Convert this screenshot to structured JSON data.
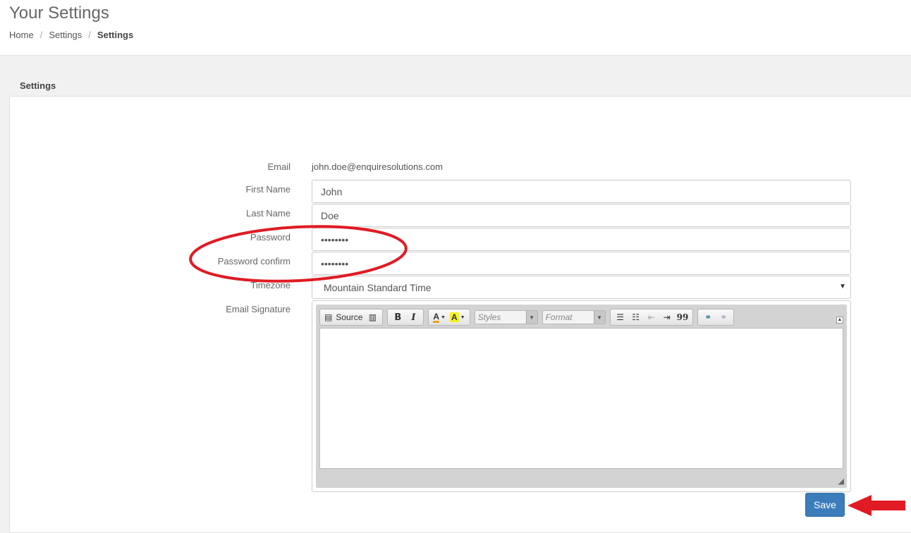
{
  "header": {
    "title": "Your Settings",
    "breadcrumb": [
      "Home",
      "Settings",
      "Settings"
    ],
    "separator": "/"
  },
  "panel": {
    "heading": "Settings"
  },
  "form": {
    "email_label": "Email",
    "email_value": "john.doe@enquiresolutions.com",
    "first_name_label": "First Name",
    "first_name_value": "John",
    "last_name_label": "Last Name",
    "last_name_value": "Doe",
    "password_label": "Password",
    "password_value": "••••••••",
    "password_confirm_label": "Password confirm",
    "password_confirm_value": "••••••••",
    "timezone_label": "Timezone",
    "timezone_value": "Mountain Standard Time",
    "signature_label": "Email Signature"
  },
  "editor": {
    "source_label": "Source",
    "bold_label": "B",
    "italic_label": "I",
    "styles_placeholder": "Styles",
    "format_placeholder": "Format",
    "blockquote_label": "99"
  },
  "actions": {
    "save_label": "Save"
  },
  "colors": {
    "annotation": "#e01b24",
    "primary": "#3b7dbb"
  }
}
